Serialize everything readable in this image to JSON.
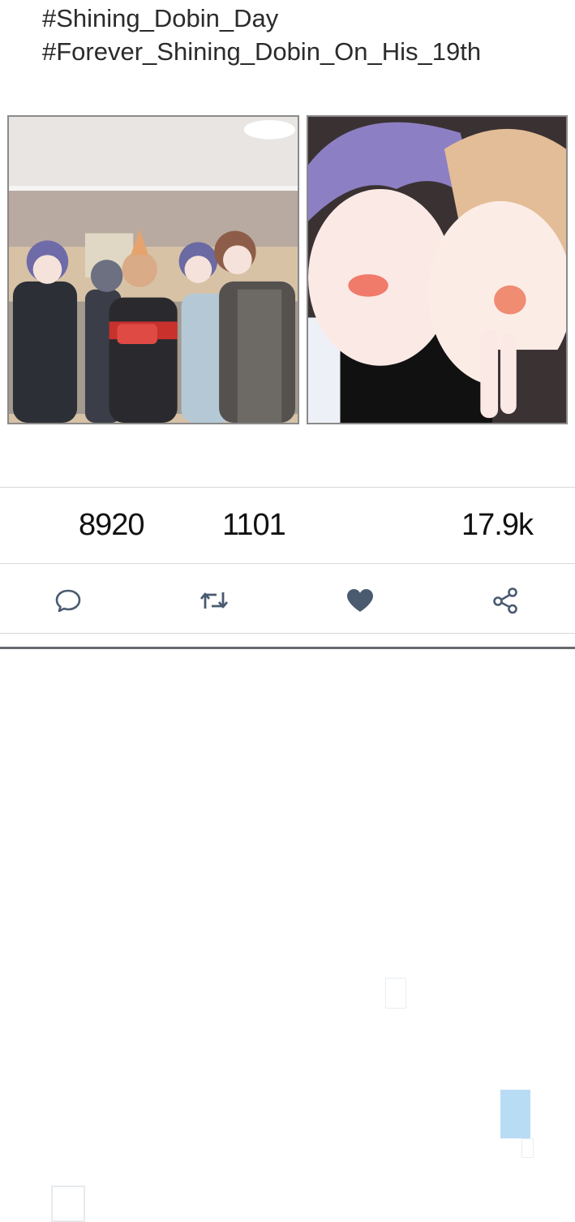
{
  "tweet": {
    "hashtags": [
      "#Shining_Dobin_Day",
      "#Forever_Shining_Dobin_On_His_19th"
    ]
  },
  "stats": {
    "replies": "8920",
    "retweets": "1101",
    "likes": "17.9k"
  },
  "actions": {
    "reply_icon": "comment-bubble-icon",
    "retweet_icon": "retweet-arrows-icon",
    "like_icon": "heart-icon",
    "share_icon": "share-nodes-icon"
  },
  "colors": {
    "icon": "#4a5b70",
    "text": "#2b2b2b",
    "divider": "#d9d9d9"
  }
}
